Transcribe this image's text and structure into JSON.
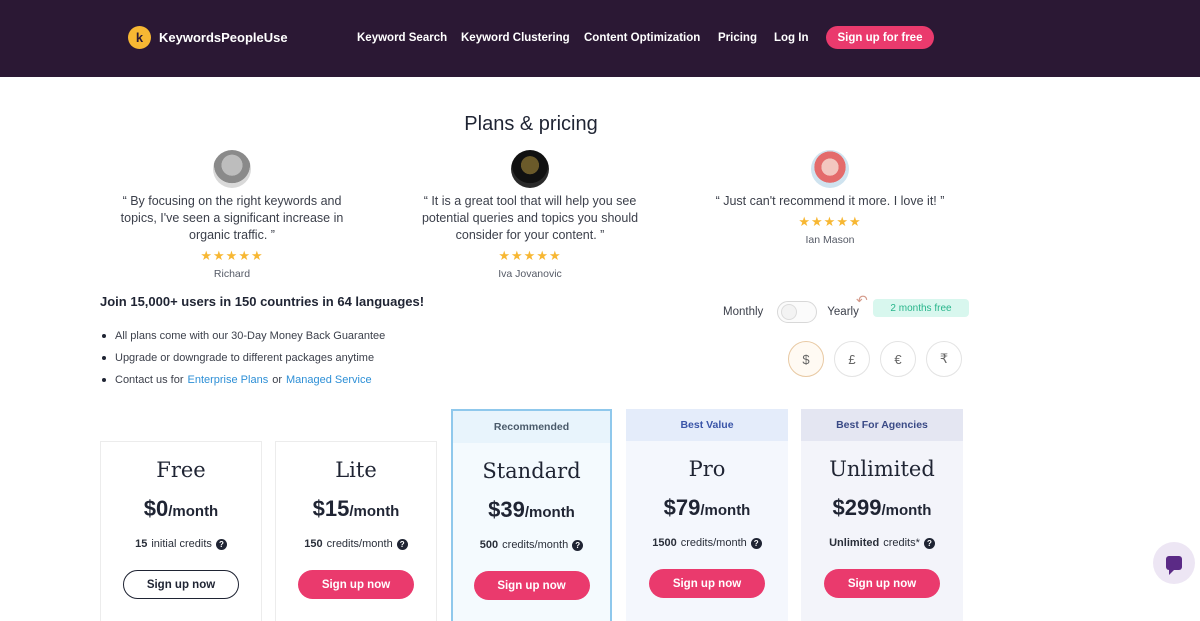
{
  "header": {
    "logo_text": "KeywordsPeopleUse",
    "logo_mark": "k",
    "nav": [
      "Keyword Search",
      "Keyword Clustering",
      "Content Optimization",
      "Pricing",
      "Log In"
    ],
    "signup": "Sign up for free"
  },
  "title": "Plans & pricing",
  "testimonials": [
    {
      "quote": "“ By focusing on the right keywords and topics, I've seen a significant increase in organic traffic. ”",
      "stars": "★★★★★",
      "author": "Richard"
    },
    {
      "quote": "“ It is a great tool that will help you see potential queries and topics you should consider for your content. ”",
      "stars": "★★★★★",
      "author": "Iva Jovanovic"
    },
    {
      "quote": "“ Just can't recommend it more. I love it! ”",
      "stars": "★★★★★",
      "author": "Ian Mason"
    }
  ],
  "join": "Join 15,000+ users in 150 countries in 64 languages!",
  "benefits": [
    "All plans come with our 30-Day Money Back Guarantee",
    "Upgrade or downgrade to different packages anytime"
  ],
  "contact": {
    "prefix": "Contact us for",
    "link1": "Enterprise Plans",
    "or": "or",
    "link2": "Managed Service"
  },
  "billing": {
    "monthly": "Monthly",
    "yearly": "Yearly",
    "badge": "2 months free"
  },
  "currencies": [
    "$",
    "£",
    "€",
    "₹"
  ],
  "plans": [
    {
      "label": "",
      "name": "Free",
      "price": "$0",
      "per": "/month",
      "credits_num": "15",
      "credits_text": "initial credits",
      "button": "Sign up now"
    },
    {
      "label": "",
      "name": "Lite",
      "price": "$15",
      "per": "/month",
      "credits_num": "150",
      "credits_text": "credits/month",
      "button": "Sign up now"
    },
    {
      "label": "Recommended",
      "name": "Standard",
      "price": "$39",
      "per": "/month",
      "credits_num": "500",
      "credits_text": "credits/month",
      "button": "Sign up now"
    },
    {
      "label": "Best Value",
      "name": "Pro",
      "price": "$79",
      "per": "/month",
      "credits_num": "1500",
      "credits_text": "credits/month",
      "button": "Sign up now"
    },
    {
      "label": "Best For Agencies",
      "name": "Unlimited",
      "price": "$299",
      "per": "/month",
      "credits_num": "Unlimited",
      "credits_text": "credits*",
      "button": "Sign up now"
    }
  ],
  "icons": {
    "question": "?",
    "chat": "chat-bubble-icon"
  },
  "colors": {
    "header_bg": "#2b1834",
    "accent": "#ea3a6d",
    "star": "#f7b733",
    "link": "#2d8fd6"
  }
}
